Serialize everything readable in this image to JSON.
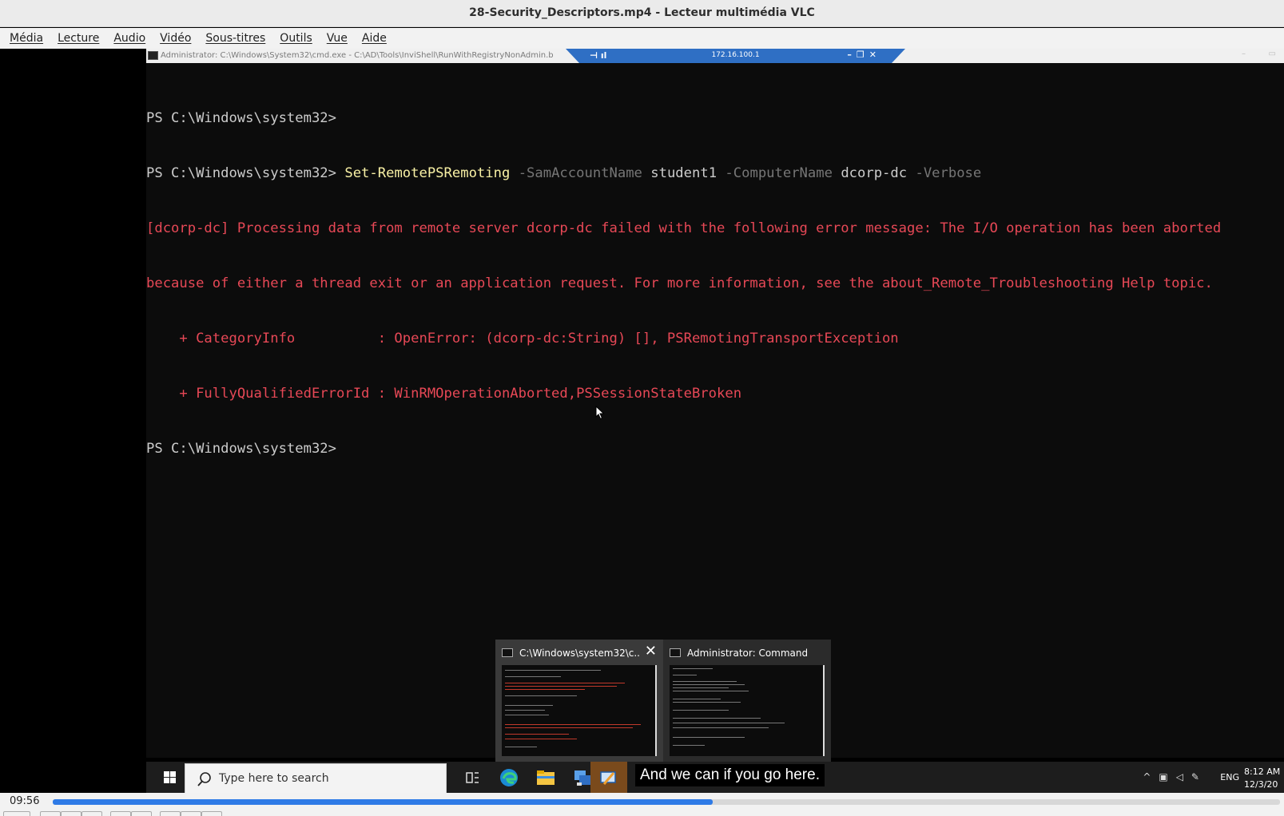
{
  "window": {
    "title": "28-Security_Descriptors.mp4 - Lecteur multimédia VLC"
  },
  "menu": [
    "Média",
    "Lecture",
    "Audio",
    "Vidéo",
    "Sous-titres",
    "Outils",
    "Vue",
    "Aide"
  ],
  "rdp": {
    "cmd_window_title": "Administrator: C:\\Windows\\System32\\cmd.exe - C:\\AD\\Tools\\InviShell\\RunWithRegistryNonAdmin.b",
    "ip": "172.16.100.1"
  },
  "console": {
    "prompt1": "PS C:\\Windows\\system32>",
    "prompt2": "PS C:\\Windows\\system32>",
    "cmdlet": "Set-RemotePSRemoting",
    "param1": "-SamAccountName",
    "arg1": "student1",
    "param2": "-ComputerName",
    "arg2": "dcorp-dc",
    "param3": "-Verbose",
    "error1": "[dcorp-dc] Processing data from remote server dcorp-dc failed with the following error message: The I/O operation has been aborted",
    "error2": "because of either a thread exit or an application request. For more information, see the about_Remote_Troubleshooting Help topic.",
    "error3": "    + CategoryInfo          : OpenError: (dcorp-dc:String) [], PSRemotingTransportException",
    "error4": "    + FullyQualifiedErrorId : WinRMOperationAborted,PSSessionStateBroken",
    "prompt3": "PS C:\\Windows\\system32>"
  },
  "thumbnails": [
    {
      "title": "C:\\Windows\\system32\\c..."
    },
    {
      "title": "Administrator: Command Prom..."
    }
  ],
  "taskbar": {
    "search_placeholder": "Type here to search",
    "caption": "And we can if you go here.",
    "language": "ENG",
    "time": "8:12 AM",
    "date": "12/3/20"
  },
  "player": {
    "elapsed": "09:56",
    "progress_fraction": 0.538
  }
}
